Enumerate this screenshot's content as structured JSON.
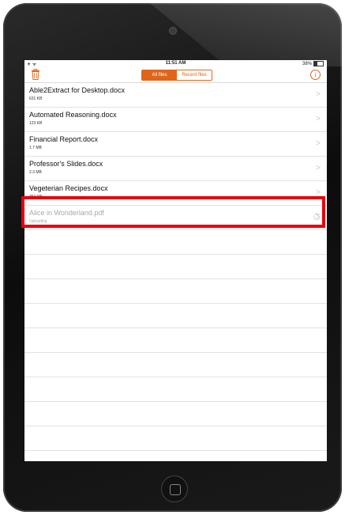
{
  "status_bar": {
    "left_icons": "✈ ᯤ",
    "time": "11:51 AM",
    "battery_percent": "38%",
    "battery_level": 0.38
  },
  "nav": {
    "trash_icon": "trash-icon",
    "segments": [
      {
        "label": "All files",
        "active": true
      },
      {
        "label": "Recent files",
        "active": false
      }
    ],
    "info_icon": "i",
    "accent_color": "#e0651a"
  },
  "files": [
    {
      "name": "Able2Extract for Desktop.docx",
      "size": "631 KB"
    },
    {
      "name": "Automated Reasoning.docx",
      "size": "123 KB"
    },
    {
      "name": "Financial Report.docx",
      "size": "1.7 MB"
    },
    {
      "name": "Professor's Slides.docx",
      "size": "2.3 MB"
    },
    {
      "name": "Vegeterian Recipes.docx",
      "size": "354 KB"
    }
  ],
  "uploading_file": {
    "name": "Alice in Wonderland.pdf",
    "status": "Uploading"
  },
  "highlight_color": "#e8000b"
}
